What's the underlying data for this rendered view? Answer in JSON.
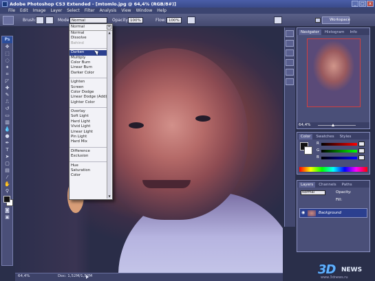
{
  "window": {
    "title": "Adobe Photoshop CS3 Extended - [mtomlo.jpg @ 64,4% (RGB/8#)]"
  },
  "menu": [
    "File",
    "Edit",
    "Image",
    "Layer",
    "Select",
    "Filter",
    "Analysis",
    "View",
    "Window",
    "Help"
  ],
  "options_bar": {
    "brush_label": "Brush:",
    "mode_label": "Mode:",
    "mode_value": "Normal",
    "opacity_label": "Opacity:",
    "opacity_value": "100%",
    "flow_label": "Flow:",
    "flow_value": "100%",
    "workspace_label": "Workspace"
  },
  "blend_dropdown": {
    "current": "Normal",
    "groups": [
      [
        "Normal",
        "Dissolve",
        "Behind"
      ],
      [
        "Darken",
        "Multiply",
        "Color Burn",
        "Linear Burn",
        "Darker Color"
      ],
      [
        "Lighten",
        "Screen",
        "Color Dodge",
        "Linear Dodge (Add)",
        "Lighter Color"
      ],
      [
        "Overlay",
        "Soft Light",
        "Hard Light",
        "Vivid Light",
        "Linear Light",
        "Pin Light",
        "Hard Mix"
      ],
      [
        "Difference",
        "Exclusion"
      ],
      [
        "Hue",
        "Saturation",
        "Color"
      ]
    ],
    "disabled": "Behind",
    "selected": "Darken"
  },
  "statusbar": {
    "zoom": "64,4%",
    "doc": "Doc: 1,52M/1,52M"
  },
  "panels": {
    "navigator_tabs": [
      "Navigator",
      "Histogram",
      "Info"
    ],
    "navigator_zoom": "64,4%",
    "color_tabs": [
      "Color",
      "Swatches",
      "Styles"
    ],
    "color_labels": [
      "R",
      "G",
      "B"
    ],
    "layers_tabs": [
      "Layers",
      "Channels",
      "Paths"
    ],
    "layer_mode": "Normal",
    "layer_opacity_label": "Opacity:",
    "layer_fill_label": "Fill:",
    "layer_name": "Background"
  },
  "colors": {
    "accent": "#2b3f8f",
    "titlebar": "#3a4a8a",
    "foreground": "#111111",
    "background_color": "#ffffff"
  },
  "watermark": {
    "brand": "3D",
    "word": "NEWS",
    "site": "www.3dnews.ru"
  }
}
